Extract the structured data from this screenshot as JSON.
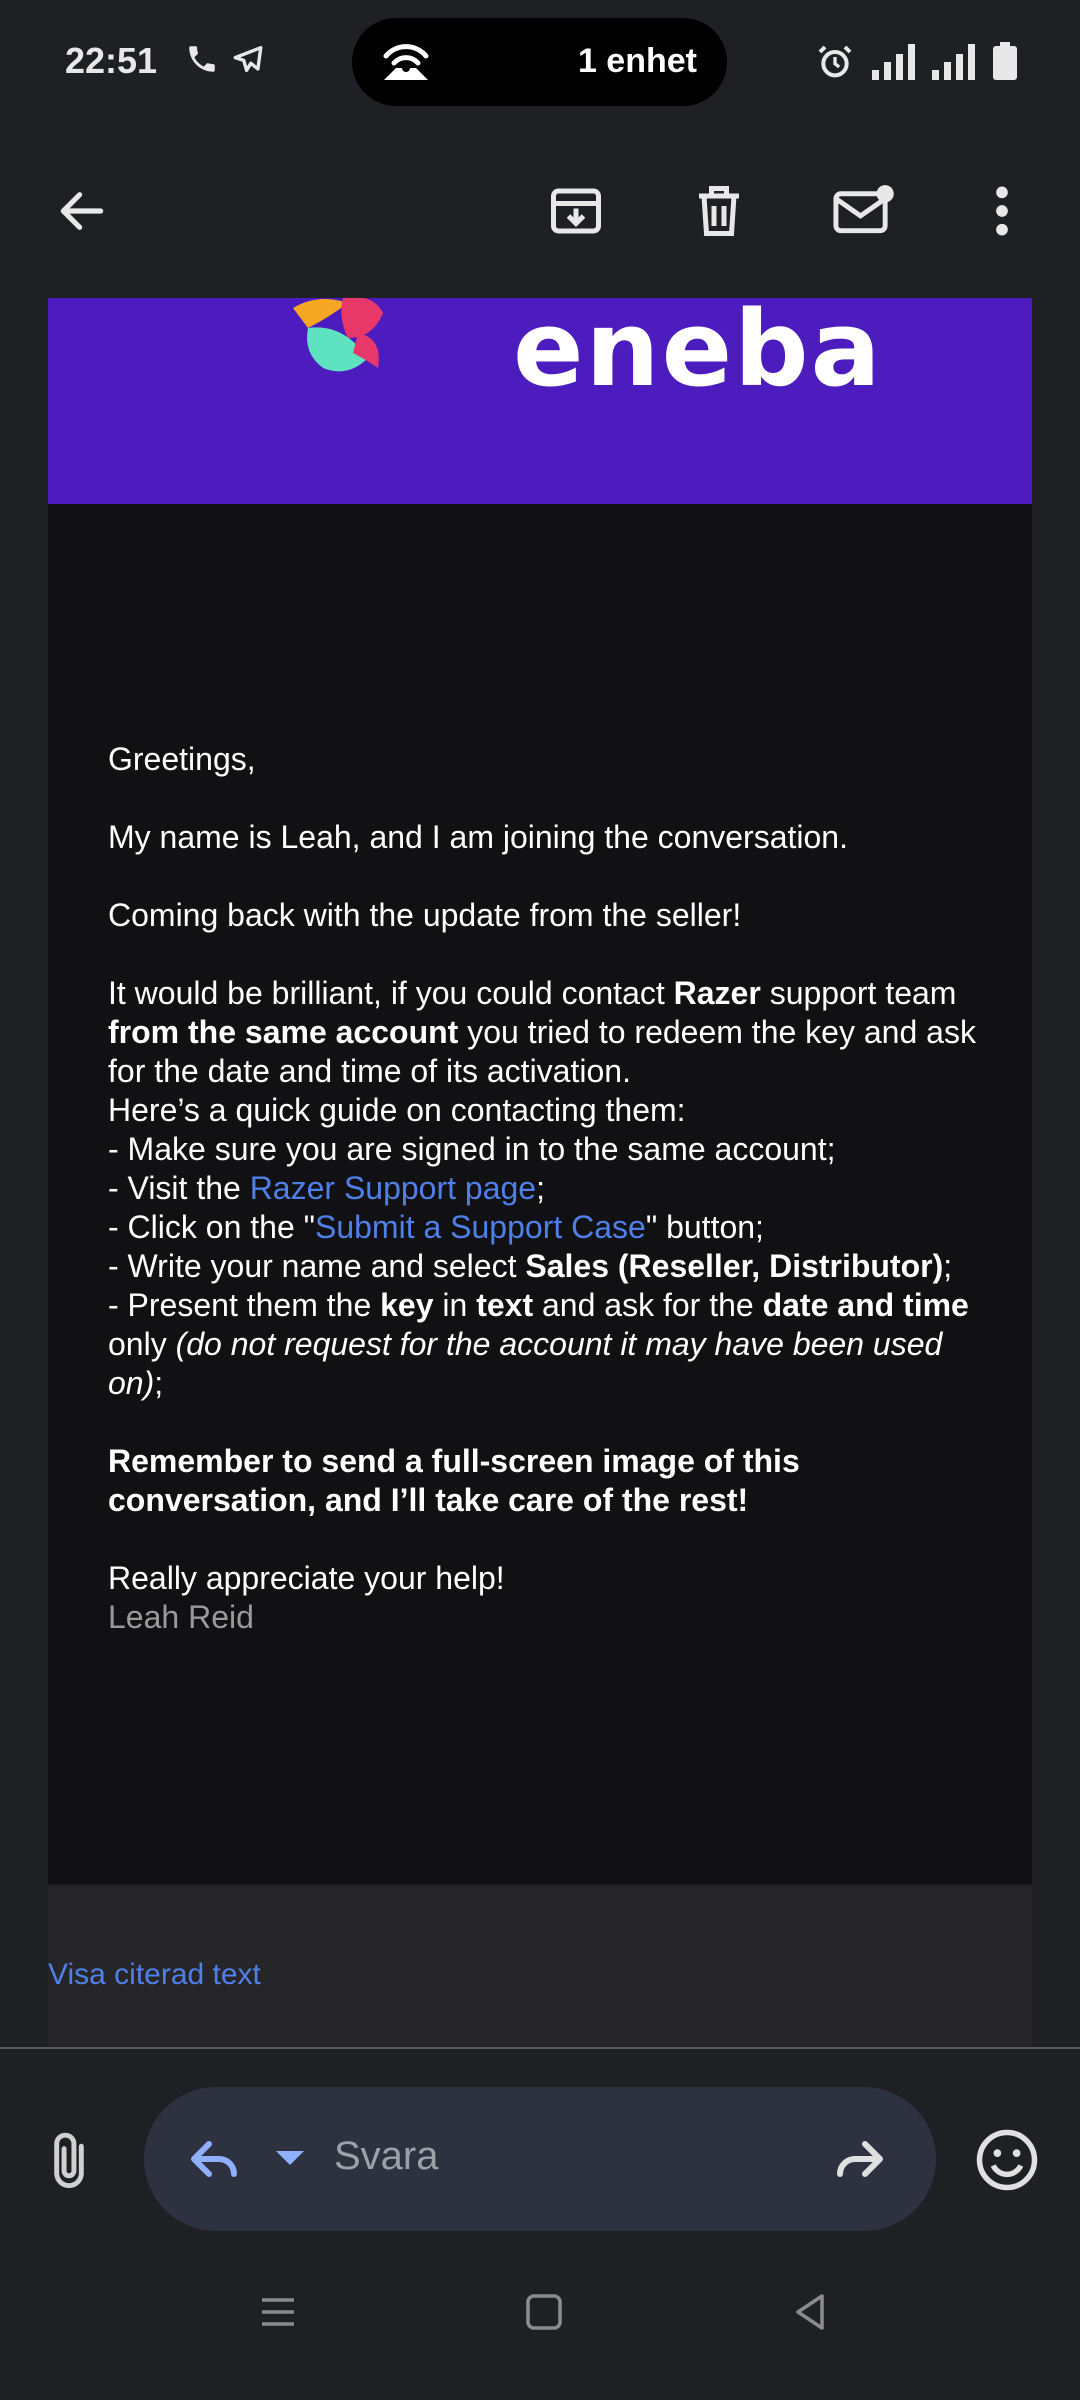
{
  "status": {
    "time": "22:51",
    "island_text": "1 enhet"
  },
  "toolbar": {
    "icons": [
      "back-arrow-icon",
      "archive-icon",
      "delete-icon",
      "mark-unread-icon",
      "more-vert-icon"
    ]
  },
  "banner": {
    "logo_text": "eneba",
    "bg_color": "#4c1cbf"
  },
  "message": {
    "greeting": "Greetings,",
    "intro": "My name is Leah, and I am joining the conversation.",
    "update": "Coming back with the update from the seller!",
    "p1_a": "It would be brilliant, if you could contact ",
    "p1_b": "Razer",
    "p1_c": " support team ",
    "p1_d": "from the same account",
    "p1_e": " you tried to redeem the key and ask for the date and time of its activation.",
    "guide_intro": "Here’s a quick guide on contacting them:",
    "step1": "- Make sure you are signed in to the same account;",
    "step2_a": "- Visit the ",
    "step2_link": "Razer Support page",
    "step2_c": ";",
    "step3_a": "- Click on the \"",
    "step3_link": "Submit a Support Case",
    "step3_c": "\" button;",
    "step4_a": "- Write your name and select ",
    "step4_b": "Sales (Reseller, Distributor)",
    "step4_c": ";",
    "step5_a": "- Present them the ",
    "step5_b": "key",
    "step5_c": " in ",
    "step5_d": "text",
    "step5_e": " and ask for the ",
    "step5_f": "date and time",
    "step5_g": " only ",
    "step5_h": "(do not request for the account it may have been used on)",
    "step5_i": ";",
    "remember": "Remember to send a full-screen image of this conversation, and I’ll take care of the rest!",
    "thanks": "Really appreciate your help!",
    "signature": "Leah Reid"
  },
  "quoted": {
    "show_label": "Visa citerad text"
  },
  "reply": {
    "placeholder": "Svara"
  },
  "colors": {
    "link": "#4f7fe8",
    "background": "#1f2024",
    "reply_box": "#2e3140"
  }
}
